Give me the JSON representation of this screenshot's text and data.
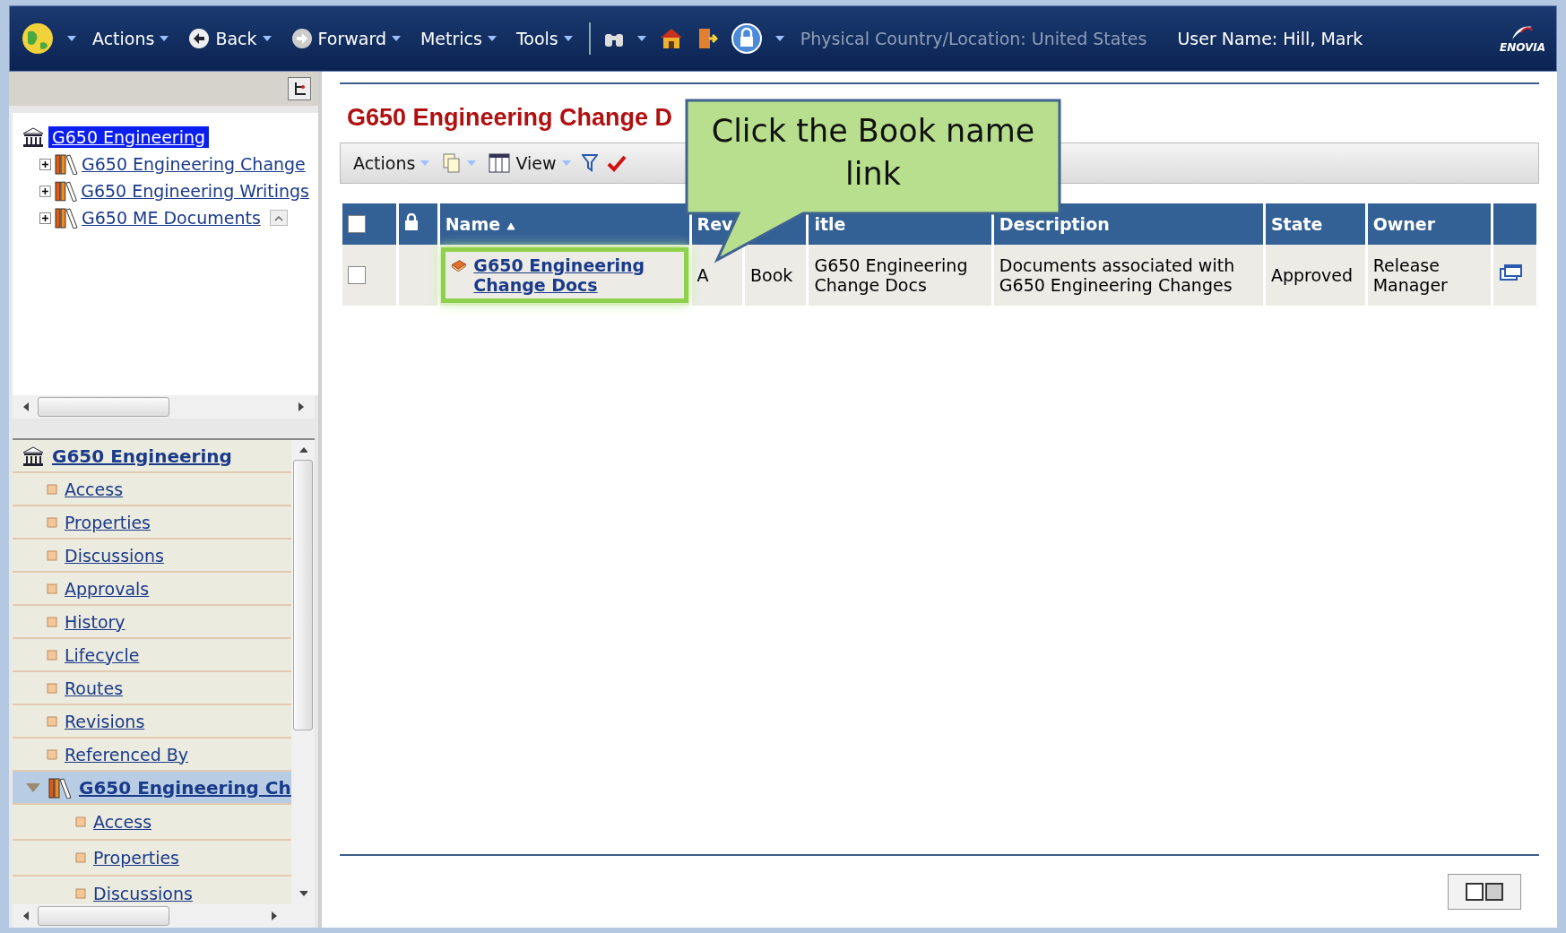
{
  "top_bar": {
    "menus": [
      {
        "label": "Actions"
      },
      {
        "label": "Back",
        "kind": "back"
      },
      {
        "label": "Forward",
        "kind": "forward"
      },
      {
        "label": "Metrics"
      },
      {
        "label": "Tools"
      }
    ],
    "location": "Physical Country/Location: United States",
    "user": "User Name: Hill, Mark",
    "logo": "ENOVIA"
  },
  "tree": {
    "label": "G650 Engineering",
    "selected": true,
    "children": [
      {
        "label": "G650 Engineering Change",
        "expanded": false
      },
      {
        "label": "G650 Engineering Writings",
        "expanded": false
      },
      {
        "label": "G650 ME Documents",
        "expanded": false,
        "collapse_button": true
      }
    ]
  },
  "nav": {
    "header": "G650 Engineering",
    "items": [
      "Access",
      "Properties",
      "Discussions",
      "Approvals",
      "History",
      "Lifecycle",
      "Routes",
      "Revisions",
      "Referenced By"
    ],
    "sub": {
      "label": "G650 Engineering Ch",
      "selected": true,
      "expanded": true,
      "items": [
        "Access",
        "Properties",
        "Discussions"
      ]
    }
  },
  "main": {
    "title": "G650 Engineering Change D",
    "toolbar": [
      {
        "label": "Actions",
        "kind": "menu"
      },
      {
        "kind": "copy"
      },
      {
        "label": "View",
        "kind": "view"
      },
      {
        "kind": "filter"
      },
      {
        "kind": "check"
      }
    ],
    "table": {
      "select_all_checked": false,
      "columns": [
        {
          "kind": "checkbox"
        },
        {
          "kind": "lock"
        },
        {
          "label": "Name",
          "sorted": true
        },
        {
          "label": "Rev"
        },
        {
          "kind": "hidden"
        },
        {
          "label": "itle"
        },
        {
          "label": "Description"
        },
        {
          "label": "State"
        },
        {
          "label": "Owner"
        },
        {
          "kind": "blank"
        }
      ],
      "rows": [
        {
          "checked": false,
          "name": "G650 Engineering Change Docs",
          "highlighted": true,
          "rev": "A",
          "type": "Book",
          "title": "G650 Engineering Change Docs",
          "description": "Documents associated with G650 Engineering Changes",
          "state": "Approved",
          "owner": "Release Manager"
        }
      ]
    }
  },
  "callout": {
    "text": "Click the Book name link"
  }
}
